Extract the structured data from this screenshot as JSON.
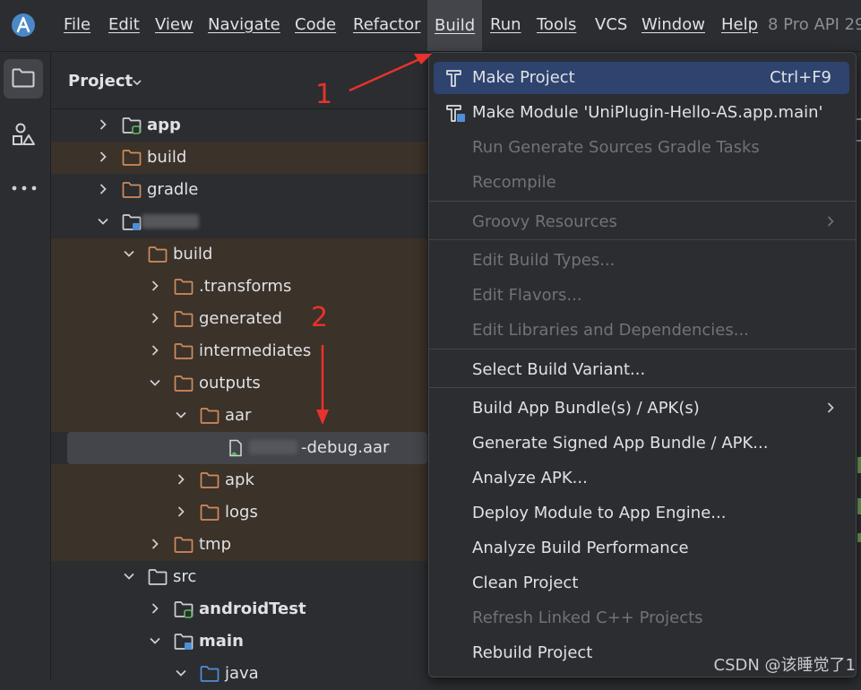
{
  "menubar": {
    "logo_icon": "android-studio-logo-icon",
    "items": [
      "File",
      "Edit",
      "View",
      "Navigate",
      "Code",
      "Refactor",
      "Build",
      "Run",
      "Tools",
      "VCS",
      "Window",
      "Help"
    ],
    "tail": "8 Pro API 29"
  },
  "sidebar": {
    "icons": [
      "folder-icon",
      "structure-icon",
      "more-icon"
    ]
  },
  "project_panel": {
    "title": "Project",
    "rows": [
      {
        "label": "app",
        "bold": true,
        "type": "module",
        "expanded": false
      },
      {
        "label": "build",
        "bold": false,
        "type": "folder",
        "expanded": false
      },
      {
        "label": "gradle",
        "bold": false,
        "type": "folder",
        "expanded": false
      },
      {
        "label": "",
        "bold": false,
        "type": "module",
        "expanded": true
      },
      {
        "label": "build",
        "bold": false,
        "type": "folder",
        "expanded": true
      },
      {
        "label": ".transforms",
        "bold": false,
        "type": "folder",
        "expanded": false
      },
      {
        "label": "generated",
        "bold": false,
        "type": "folder",
        "expanded": false
      },
      {
        "label": "intermediates",
        "bold": false,
        "type": "folder",
        "expanded": false
      },
      {
        "label": "outputs",
        "bold": false,
        "type": "folder",
        "expanded": true
      },
      {
        "label": "aar",
        "bold": false,
        "type": "folder",
        "expanded": true
      },
      {
        "label": "-debug.aar",
        "bold": false,
        "type": "aar-file"
      },
      {
        "label": "apk",
        "bold": false,
        "type": "folder",
        "expanded": false
      },
      {
        "label": "logs",
        "bold": false,
        "type": "folder",
        "expanded": false
      },
      {
        "label": "tmp",
        "bold": false,
        "type": "folder",
        "expanded": false
      },
      {
        "label": "src",
        "bold": false,
        "type": "folder",
        "expanded": true
      },
      {
        "label": "androidTest",
        "bold": true,
        "type": "source-folder",
        "expanded": false
      },
      {
        "label": "main",
        "bold": true,
        "type": "source-folder",
        "expanded": true
      },
      {
        "label": "java",
        "bold": false,
        "type": "java-folder",
        "expanded": true
      }
    ]
  },
  "build_menu": {
    "items": [
      {
        "label": "Make Project",
        "shortcut": "Ctrl+F9",
        "icon": "hammer-icon",
        "enabled": true,
        "hover": true
      },
      {
        "label": "Make Module 'UniPlugin-Hello-AS.app.main'",
        "icon": "hammer-module-icon",
        "enabled": true
      },
      {
        "label": "Run Generate Sources Gradle Tasks",
        "enabled": false
      },
      {
        "label": "Recompile",
        "enabled": false
      },
      {
        "label": "Groovy Resources",
        "enabled": false,
        "submenu": true
      },
      {
        "label": "Edit Build Types...",
        "enabled": false
      },
      {
        "label": "Edit Flavors...",
        "enabled": false
      },
      {
        "label": "Edit Libraries and Dependencies...",
        "enabled": false
      },
      {
        "label": "Select Build Variant...",
        "enabled": true
      },
      {
        "label": "Build App Bundle(s) / APK(s)",
        "enabled": true,
        "submenu": true
      },
      {
        "label": "Generate Signed App Bundle / APK...",
        "enabled": true
      },
      {
        "label": "Analyze APK...",
        "enabled": true
      },
      {
        "label": "Deploy Module to App Engine...",
        "enabled": true
      },
      {
        "label": "Analyze Build Performance",
        "enabled": true
      },
      {
        "label": "Clean Project",
        "enabled": true
      },
      {
        "label": "Refresh Linked C++ Projects",
        "enabled": false
      },
      {
        "label": "Rebuild Project",
        "enabled": true
      }
    ]
  },
  "annotations": {
    "step1": "1",
    "step2": "2",
    "color": "#e8322c"
  },
  "watermark": "CSDN @该睡觉了1"
}
